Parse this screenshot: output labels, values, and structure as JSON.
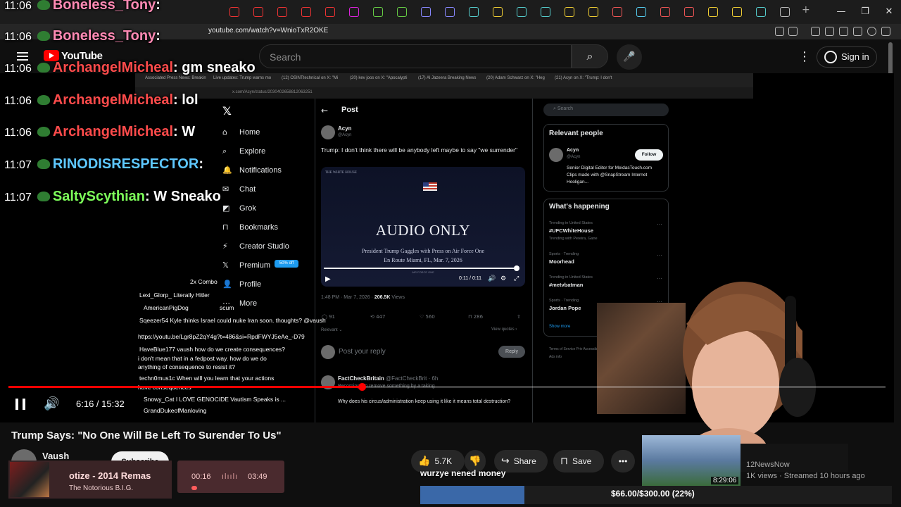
{
  "browser": {
    "url": "youtube.com/watch?v=WnioTxR2OKE",
    "window_controls": [
      "—",
      "❐",
      "✕"
    ],
    "new_tab": "+"
  },
  "youtube": {
    "logo_text": "YouTube",
    "search_placeholder": "Search",
    "search_icon": "search-icon",
    "mic_icon": "mic-icon",
    "signin_label": "Sign in",
    "player": {
      "current_time": "6:16",
      "duration": "15:32",
      "clock": "6:16 / 15:32",
      "progress_fraction": 0.403
    },
    "video_title": "Trump Says: \"No One Will Be Left To Surender To Us\"",
    "channel_name": "Vaush",
    "subscribe_label": "Subscribe",
    "likes": "5.7K",
    "share_label": "Share",
    "save_label": "Save",
    "more_label": "•••"
  },
  "inner_browser": {
    "url": "x.com/Acyn/status/2030402658812063251",
    "tabs": [
      "Associated Press News: Breakin",
      "Live updates: Trump warns mo",
      "(12) OSINTtechnical on X: \"Mi",
      "(20) kev joos on X: \"Apocalypti",
      "(17) Al Jazeera Breaking News",
      "(20) Adam Schwarz on X: \"Heg",
      "(21) Acyn on X: \"Trump: I don't"
    ]
  },
  "x": {
    "logo": "𝕏",
    "nav": [
      {
        "icon": "⌂",
        "label": "Home"
      },
      {
        "icon": "⌕",
        "label": "Explore"
      },
      {
        "icon": "🔔",
        "label": "Notifications"
      },
      {
        "icon": "✉",
        "label": "Chat"
      },
      {
        "icon": "◩",
        "label": "Grok"
      },
      {
        "icon": "⊓",
        "label": "Bookmarks"
      },
      {
        "icon": "⚡",
        "label": "Creator Studio"
      },
      {
        "icon": "𝕏",
        "label": "Premium"
      },
      {
        "icon": "👤",
        "label": "Profile"
      },
      {
        "icon": "⋯",
        "label": "More"
      }
    ],
    "premium_badge": "50% off",
    "post_header": "Post",
    "author_name": "Acyn",
    "author_handle": "@Acyn",
    "post_text": "Trump: I don't think there will be anybody left maybe to say \"we surrender\"",
    "media": {
      "house": "THE WHITE HOUSE",
      "headline": "AUDIO ONLY",
      "line1": "President Trump Gaggles with Press on Air Force One",
      "line2": "En Route Miami, FL, Mar. 7, 2026",
      "footer": "AIR FORCE ONE",
      "time": "0:11 / 0:11"
    },
    "post_time": "1:48 PM · Mar 7, 2026 · ",
    "views_count": "206.5K",
    "views_label": " Views",
    "stats": {
      "replies": "91",
      "reposts": "447",
      "likes": "560",
      "bookmarks": "286"
    },
    "relevant_label": "Relevant ⌄",
    "view_quotes": "View quotes ›",
    "reply_placeholder": "Post your reply",
    "reply_button": "Reply",
    "reply_author": "FactCheckBritain",
    "reply_handle": " @FactCheckBrit · 6h",
    "reply_sub": "Becoming: To remove something by a taking",
    "reply_text": "Why does his circus/administration keep using it like it means total destruction?",
    "search_placeholder": "Search",
    "relevant_people": "Relevant people",
    "follow_label": "Follow",
    "bio": "Senior Digital Editor for MeidasTouch.com Clips made with @SnapStream Internet Hooligan...",
    "whats_happening": "What's happening",
    "trends": [
      {
        "ctx": "Trending in United States",
        "name": "#UFCWhiteHouse",
        "sub": "Trending with Pereira, Gane"
      },
      {
        "ctx": "Sports · Trending",
        "name": "Moorhead",
        "sub": ""
      },
      {
        "ctx": "Trending in United States",
        "name": "#metvbatman",
        "sub": ""
      },
      {
        "ctx": "Sports · Trending",
        "name": "Jordan Pope",
        "sub": ""
      }
    ],
    "show_more": "Show more",
    "footer_links": "Terms of Service  Priv  Accessibility  Ads info"
  },
  "stream_chat": [
    {
      "time": "11:06",
      "user": "Boneless_Tony",
      "msg": ":",
      "color": "#ff8ab4"
    },
    {
      "time": "11:06",
      "user": "Boneless_Tony",
      "msg": ":",
      "color": "#ff8ab4"
    },
    {
      "time": "11:06",
      "user": "ArchangelMicheal",
      "msg": ": gm sneako",
      "color": "#ff4b4b"
    },
    {
      "time": "11:06",
      "user": "ArchangelMicheal",
      "msg": ": lol",
      "color": "#ff4b4b"
    },
    {
      "time": "11:06",
      "user": "ArchangelMicheal",
      "msg": ": W",
      "color": "#ff4b4b"
    },
    {
      "time": "11:07",
      "user": "RINODISRESPECTOR",
      "msg": ":",
      "color": "#5ec8ff"
    },
    {
      "time": "11:07",
      "user": "SaltyScythian",
      "msg": ": W Sneako",
      "color": "#7dff5a"
    }
  ],
  "small_chat": [
    {
      "text": "2x  Combo",
      "cls": ""
    },
    {
      "text": "Lexi_Glorp_   Literally Hitler",
      "cls": ""
    },
    {
      "text": "AmericanPigDog",
      "cls": "r"
    },
    {
      "text": "scum",
      "cls": ""
    },
    {
      "text": "Sqeezer54   Kyle thinks Israel could nuke Iran soon. thoughts? @vaush",
      "cls": ""
    },
    {
      "text": "https://youtu.be/Lgr8pZ2qY4g?t=486&si=RpdFWYJ5eAe_-D79",
      "cls": "lk"
    },
    {
      "text": "HaveBlue177   vaush how do we create consequences?",
      "cls": ""
    },
    {
      "text": "i don't mean that in a fedpost way. how do we do",
      "cls": ""
    },
    {
      "text": "anything of consequence to resist it?",
      "cls": ""
    },
    {
      "text": "techn0mus1c   When will you learn that your actions",
      "cls": ""
    },
    {
      "text": "have consequences",
      "cls": ""
    },
    {
      "text": "Snowy_Cat   I LOVE GENOCIDE Vautism Speaks is ...",
      "cls": ""
    },
    {
      "text": "GrandDukeofManloving",
      "cls": "r"
    }
  ],
  "music": {
    "song": "otize - 2014 Remas",
    "artist": "The Notorious B.I.G.",
    "elapsed": "00:16",
    "total": "03:49",
    "bars": "ılıılı"
  },
  "donation": {
    "donor_text": "wurzye nened money",
    "goal_text": "$66.00/$300.00 (22%)",
    "goal_fraction": 0.22
  },
  "recommended": {
    "duration": "8:29:06",
    "channel": "12NewsNow",
    "meta": "1K views · Streamed 10 hours ago"
  }
}
